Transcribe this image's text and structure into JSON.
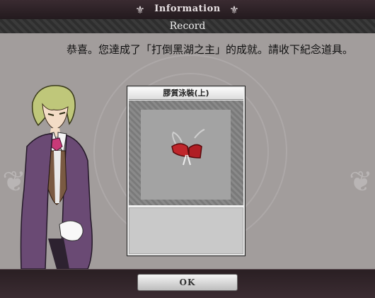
{
  "window": {
    "title": "Information",
    "subtitle": "Record"
  },
  "message": "恭喜。您達成了「打倒黑湖之主」的成就。請收下紀念道具。",
  "item": {
    "name": "膠質泳裝(上)",
    "description": ""
  },
  "buttons": {
    "ok_label": "OK"
  },
  "icons": {
    "title_ornament": "fleur-icon",
    "item": "swimsuit-top-icon"
  },
  "colors": {
    "panel": "#a29d9c",
    "titlebar": "#2b2226",
    "accent": "#c0262b"
  }
}
